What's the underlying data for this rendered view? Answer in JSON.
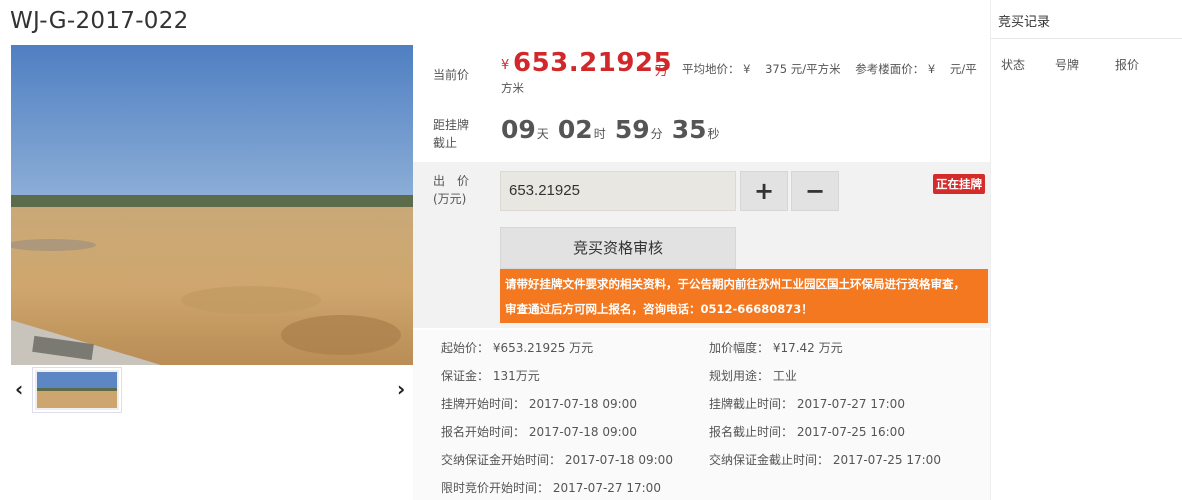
{
  "title": "WJ-G-2017-022",
  "gallery": {
    "prev_label": "‹",
    "next_label": "›"
  },
  "price": {
    "label": "当前价",
    "currency": "¥",
    "value": "653.21925",
    "unit": "万",
    "avg_label": "平均地价：",
    "avg_currency": "¥",
    "avg_value": "375 元/平方米",
    "ref_label": "参考楼面价：",
    "ref_currency": "¥",
    "ref_value_part1": "元/平",
    "ref_value_part2": "方米"
  },
  "countdown": {
    "label_line1": "距挂牌",
    "label_line2": "截止",
    "days": "09",
    "days_unit": "天",
    "hours": "02",
    "hours_unit": "时",
    "minutes": "59",
    "minutes_unit": "分",
    "seconds": "35",
    "seconds_unit": "秒"
  },
  "bid": {
    "label_line1": "出　价",
    "label_line2": "(万元)",
    "input_value": "653.21925",
    "plus_label": "+",
    "minus_label": "−",
    "status_badge": "正在挂牌",
    "qualify_button": "竞买资格审核",
    "notice_line1": "请带好挂牌文件要求的相关资料，于公告期内前往苏州工业园区国土环保局进行资格审查，",
    "notice_line2": "审查通过后方可网上报名，咨询电话：0512-66680873！"
  },
  "details": {
    "start_price": "起始价：  ¥653.21925  万元",
    "increment": "加价幅度：  ¥17.42  万元",
    "deposit": "保证金：  131万元",
    "usage": "规划用途：  工业",
    "listing_start": "挂牌开始时间：  2017-07-18 09:00",
    "listing_end": "挂牌截止时间：  2017-07-27 17:00",
    "signup_start": "报名开始时间：  2017-07-18 09:00",
    "signup_end": "报名截止时间：  2017-07-25 16:00",
    "deposit_start": "交纳保证金开始时间：  2017-07-18 09:00",
    "deposit_end": "交纳保证金截止时间：  2017-07-25 17:00",
    "timed_bid_start": "限时竞价开始时间：  2017-07-27 17:00"
  },
  "sidebar": {
    "title": "竞买记录",
    "columns": [
      "状态",
      "号牌",
      "报价"
    ]
  },
  "colors": {
    "price_red": "#d1282b",
    "notice_orange": "#f3781f",
    "badge_red": "#d52b2b"
  }
}
